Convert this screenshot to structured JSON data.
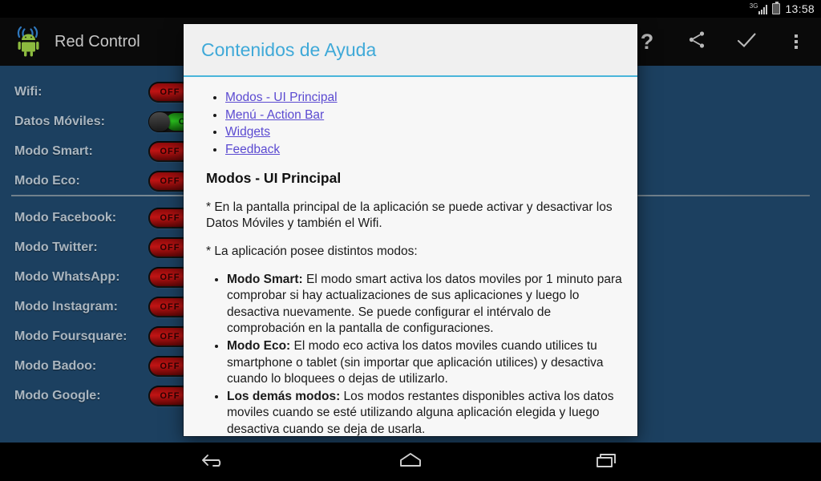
{
  "status_bar": {
    "network_label": "3G",
    "signal_icon": "signal-bars-icon",
    "battery_icon": "battery-icon",
    "clock": "13:58"
  },
  "action_bar": {
    "app_title": "Red Control",
    "logo_icon": "android-wifi-logo-icon",
    "actions": [
      {
        "name": "help-button",
        "icon": "question-mark-icon",
        "label": "?"
      },
      {
        "name": "share-button",
        "icon": "share-icon",
        "label": ""
      },
      {
        "name": "confirm-button",
        "icon": "checkmark-icon",
        "label": ""
      },
      {
        "name": "overflow-button",
        "icon": "overflow-menu-icon",
        "label": ""
      }
    ]
  },
  "main": {
    "rows": [
      {
        "label": "Wifi:",
        "state": "OFF"
      },
      {
        "label": "Datos Móviles:",
        "state": "ON"
      },
      {
        "label": "Modo Smart:",
        "state": "OFF"
      },
      {
        "label": "Modo Eco:",
        "state": "OFF"
      },
      {
        "label": "Modo Facebook:",
        "state": "OFF"
      },
      {
        "label": "Modo Twitter:",
        "state": "OFF"
      },
      {
        "label": "Modo WhatsApp:",
        "state": "OFF"
      },
      {
        "label": "Modo Instagram:",
        "state": "OFF"
      },
      {
        "label": "Modo Foursquare:",
        "state": "OFF"
      },
      {
        "label": "Modo Badoo:",
        "state": "OFF"
      },
      {
        "label": "Modo Google:",
        "state": "OFF"
      }
    ]
  },
  "dialog": {
    "title": "Contenidos de Ayuda",
    "toc": [
      "Modos - UI Principal",
      "Menú - Action Bar",
      "Widgets",
      "Feedback"
    ],
    "section_heading": "Modos - UI Principal",
    "paragraphs": [
      "* En la pantalla principal de la aplicación se puede activar y desactivar los Datos Móviles y también el Wifi.",
      "* La aplicación posee distintos modos:"
    ],
    "modes": [
      {
        "term": "Modo Smart:",
        "text": " El modo smart activa los datos moviles por 1 minuto para comprobar si hay actualizaciones de sus aplicaciones y luego lo desactiva nuevamente. Se puede configurar el intérvalo de comprobación en la pantalla de configuraciones."
      },
      {
        "term": "Modo Eco:",
        "text": " El modo eco activa los datos moviles cuando utilices tu smartphone o tablet (sin importar que aplicación utilices) y desactiva cuando lo bloquees o dejas de utilizarlo."
      },
      {
        "term": "Los demás modos:",
        "text": " Los modos restantes disponibles activa los datos moviles cuando se esté utilizando alguna aplicación elegida y luego desactiva cuando se deja de usarla."
      }
    ]
  },
  "nav_bar": {
    "buttons": [
      {
        "name": "back-button",
        "icon": "back-arrow-icon"
      },
      {
        "name": "home-button",
        "icon": "home-icon"
      },
      {
        "name": "recents-button",
        "icon": "recents-icon"
      }
    ]
  },
  "colors": {
    "background": "#1c4060",
    "accent": "#3fa9d8",
    "toggle_on": "#2bc41f",
    "toggle_off": "#c01414",
    "link": "#5b4ad1"
  }
}
